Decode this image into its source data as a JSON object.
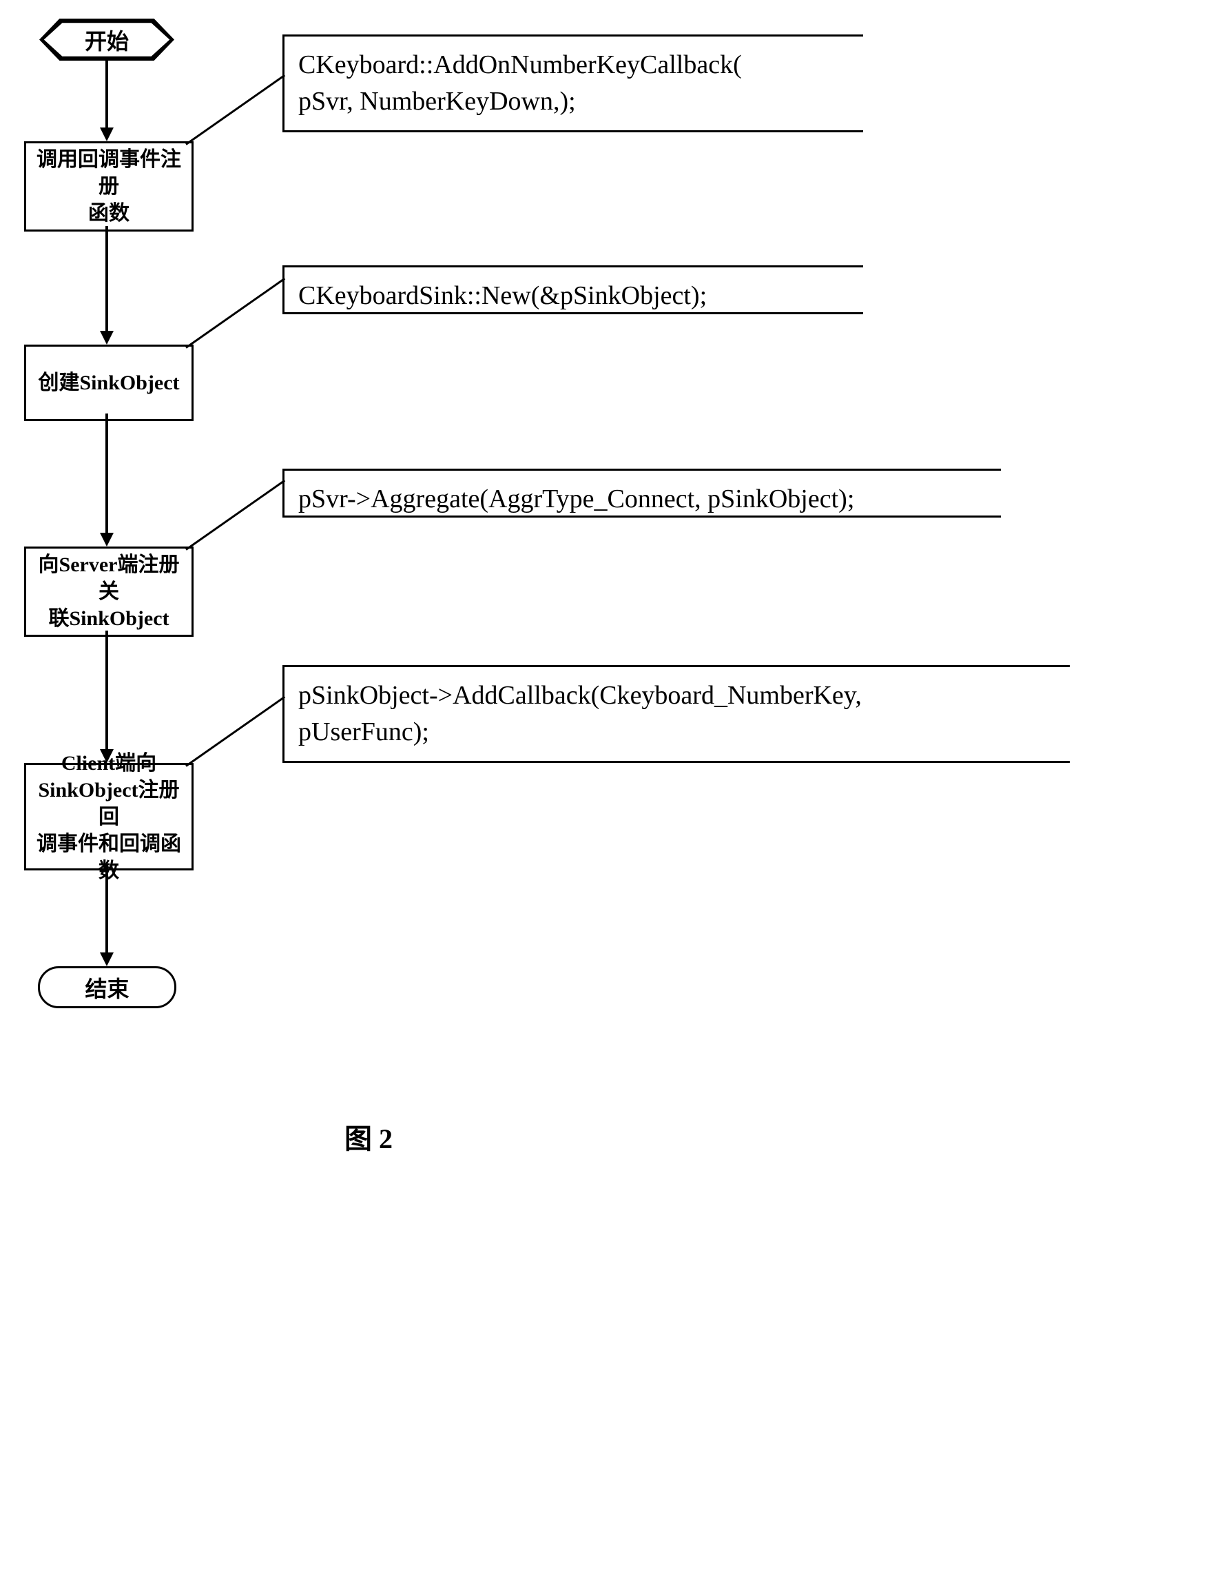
{
  "flowchart": {
    "start": "开始",
    "end": "结束",
    "steps": [
      {
        "label": "调用回调事件注册\n函数",
        "annotation": "CKeyboard::AddOnNumberKeyCallback(\n    pSvr, NumberKeyDown,);"
      },
      {
        "label": "创建SinkObject",
        "annotation": "CKeyboardSink::New(&pSinkObject);"
      },
      {
        "label": "向Server端注册关\n联SinkObject",
        "annotation": "pSvr->Aggregate(AggrType_Connect, pSinkObject);"
      },
      {
        "label": "Client端向\nSinkObject注册回\n调事件和回调函数",
        "annotation": "pSinkObject->AddCallback(Ckeyboard_NumberKey,\n    pUserFunc);"
      }
    ]
  },
  "figure_label": "图 2"
}
